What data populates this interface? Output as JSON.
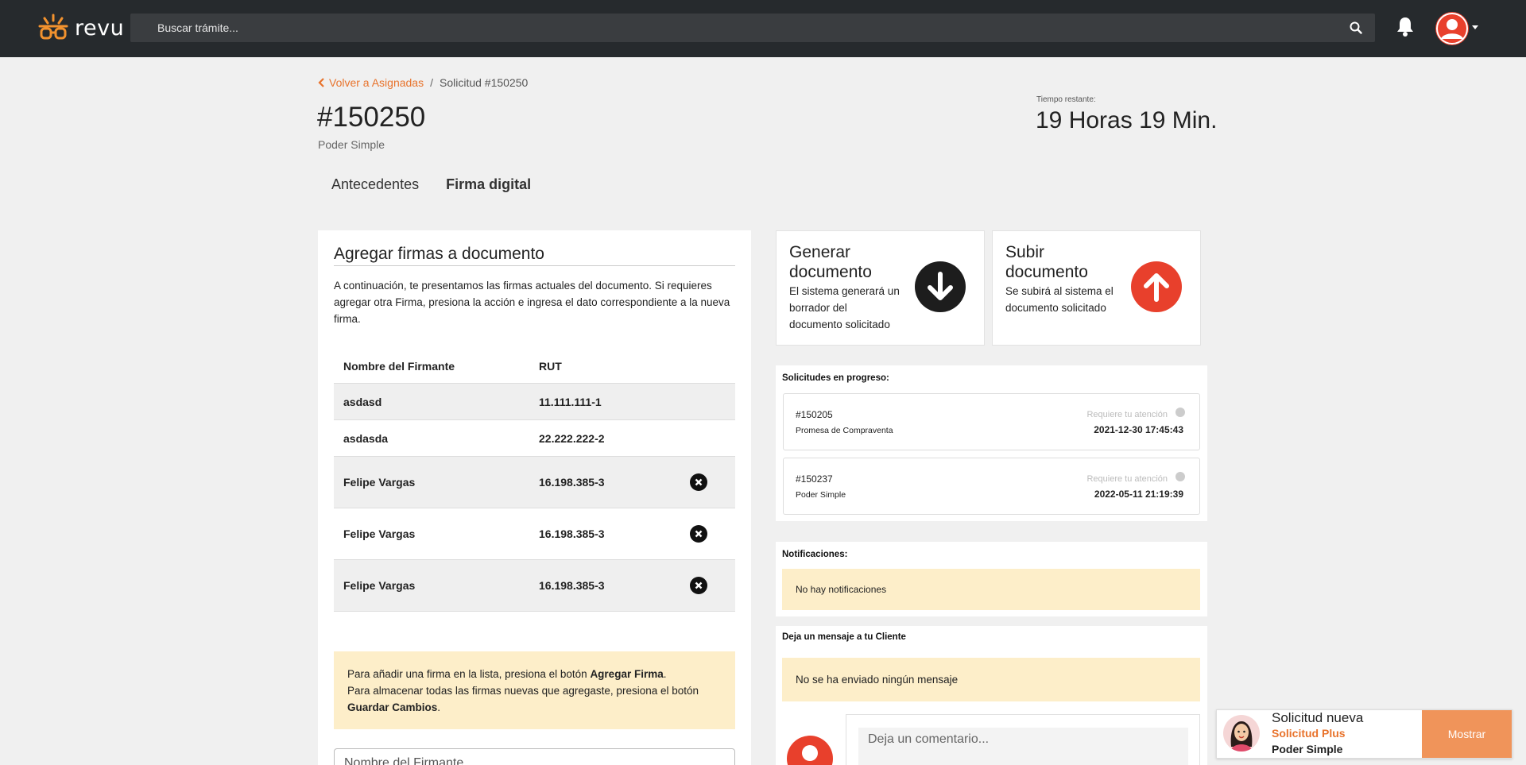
{
  "colors": {
    "topbar": "#262a2d",
    "accent": "#e8732c",
    "brand_red": "#e8402c",
    "info_bg": "#fdeec9",
    "page_bg": "#f0f0f0"
  },
  "header": {
    "logo_text": "revu",
    "search_placeholder": "Buscar trámite...",
    "icons": [
      "revu-logo-icon",
      "search-icon",
      "bell-icon",
      "user-avatar-icon",
      "caret-down-icon"
    ]
  },
  "breadcrumb": {
    "back_label": "Volver a Asignadas",
    "separator": "/",
    "current": "Solicitud #150250"
  },
  "page": {
    "title": "#150250",
    "subtitle": "Poder Simple",
    "time_label": "Tiempo restante:",
    "time_value": "19 Horas 19 Min."
  },
  "tabs": [
    {
      "label": "Antecedentes",
      "active": false
    },
    {
      "label": "Firma digital",
      "active": true
    }
  ],
  "signatures": {
    "title": "Agregar firmas a documento",
    "description": "A continuación, te presentamos las firmas actuales del documento. Si requieres agregar otra Firma, presiona la acción e ingresa el dato correspondiente a la nueva firma.",
    "columns": {
      "name": "Nombre del Firmante",
      "rut": "RUT"
    },
    "rows": [
      {
        "name": "asdasd",
        "rut": "11.111.111-1",
        "removable": false
      },
      {
        "name": "asdasda",
        "rut": "22.222.222-2",
        "removable": false
      },
      {
        "name": "Felipe Vargas",
        "rut": "16.198.385-3",
        "removable": true
      },
      {
        "name": "Felipe Vargas",
        "rut": "16.198.385-3",
        "removable": true
      },
      {
        "name": "Felipe Vargas",
        "rut": "16.198.385-3",
        "removable": true
      }
    ],
    "info": {
      "line1_pre": "Para añadir una firma en la lista, presiona el botón ",
      "line1_bold": "Agregar Firma",
      "line1_post": ".",
      "line2_pre": "Para almacenar todas las firmas nuevas que agregaste, presiona el botón ",
      "line2_bold": "Guardar Cambios",
      "line2_post": "."
    },
    "name_input_placeholder": "Nombre del Firmante"
  },
  "actions": {
    "generate": {
      "title_1": "Generar",
      "title_2": "documento",
      "desc_1": "El sistema generará un",
      "desc_2": "borrador del",
      "desc_3": "documento solicitado",
      "icon": "download-arrow-icon"
    },
    "upload": {
      "title_1": "Subir",
      "title_2": "documento",
      "desc_1": "Se subirá al sistema el",
      "desc_2": "documento solicitado",
      "icon": "upload-arrow-icon"
    }
  },
  "in_progress": {
    "title": "Solicitudes en progreso:",
    "items": [
      {
        "id": "#150205",
        "type": "Promesa de Compraventa",
        "attention": "Requiere tu atención",
        "date": "2021-12-30 17:45:43"
      },
      {
        "id": "#150237",
        "type": "Poder Simple",
        "attention": "Requiere tu atención",
        "date": "2022-05-11 21:19:39"
      }
    ]
  },
  "notifications": {
    "title": "Notificaciones:",
    "empty": "No hay notificaciones"
  },
  "message": {
    "title": "Deja un mensaje a tu Cliente",
    "empty": "No se ha enviado ningún mensaje",
    "comment_placeholder": "Deja un comentario..."
  },
  "toast": {
    "line1": "Solicitud nueva",
    "line2": "Solicitud Plus",
    "line3": "Poder Simple",
    "button": "Mostrar"
  }
}
